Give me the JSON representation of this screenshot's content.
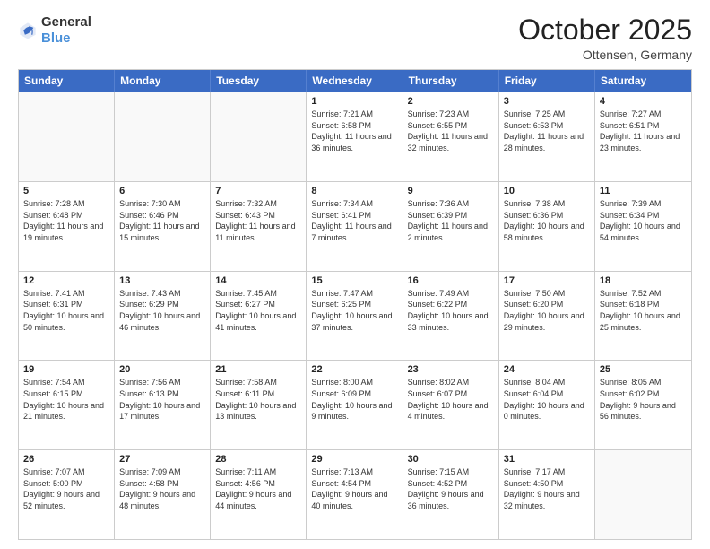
{
  "logo": {
    "general": "General",
    "blue": "Blue"
  },
  "title": "October 2025",
  "location": "Ottensen, Germany",
  "header_days": [
    "Sunday",
    "Monday",
    "Tuesday",
    "Wednesday",
    "Thursday",
    "Friday",
    "Saturday"
  ],
  "weeks": [
    [
      {
        "day": "",
        "sunrise": "",
        "sunset": "",
        "daylight": ""
      },
      {
        "day": "",
        "sunrise": "",
        "sunset": "",
        "daylight": ""
      },
      {
        "day": "",
        "sunrise": "",
        "sunset": "",
        "daylight": ""
      },
      {
        "day": "1",
        "sunrise": "Sunrise: 7:21 AM",
        "sunset": "Sunset: 6:58 PM",
        "daylight": "Daylight: 11 hours and 36 minutes."
      },
      {
        "day": "2",
        "sunrise": "Sunrise: 7:23 AM",
        "sunset": "Sunset: 6:55 PM",
        "daylight": "Daylight: 11 hours and 32 minutes."
      },
      {
        "day": "3",
        "sunrise": "Sunrise: 7:25 AM",
        "sunset": "Sunset: 6:53 PM",
        "daylight": "Daylight: 11 hours and 28 minutes."
      },
      {
        "day": "4",
        "sunrise": "Sunrise: 7:27 AM",
        "sunset": "Sunset: 6:51 PM",
        "daylight": "Daylight: 11 hours and 23 minutes."
      }
    ],
    [
      {
        "day": "5",
        "sunrise": "Sunrise: 7:28 AM",
        "sunset": "Sunset: 6:48 PM",
        "daylight": "Daylight: 11 hours and 19 minutes."
      },
      {
        "day": "6",
        "sunrise": "Sunrise: 7:30 AM",
        "sunset": "Sunset: 6:46 PM",
        "daylight": "Daylight: 11 hours and 15 minutes."
      },
      {
        "day": "7",
        "sunrise": "Sunrise: 7:32 AM",
        "sunset": "Sunset: 6:43 PM",
        "daylight": "Daylight: 11 hours and 11 minutes."
      },
      {
        "day": "8",
        "sunrise": "Sunrise: 7:34 AM",
        "sunset": "Sunset: 6:41 PM",
        "daylight": "Daylight: 11 hours and 7 minutes."
      },
      {
        "day": "9",
        "sunrise": "Sunrise: 7:36 AM",
        "sunset": "Sunset: 6:39 PM",
        "daylight": "Daylight: 11 hours and 2 minutes."
      },
      {
        "day": "10",
        "sunrise": "Sunrise: 7:38 AM",
        "sunset": "Sunset: 6:36 PM",
        "daylight": "Daylight: 10 hours and 58 minutes."
      },
      {
        "day": "11",
        "sunrise": "Sunrise: 7:39 AM",
        "sunset": "Sunset: 6:34 PM",
        "daylight": "Daylight: 10 hours and 54 minutes."
      }
    ],
    [
      {
        "day": "12",
        "sunrise": "Sunrise: 7:41 AM",
        "sunset": "Sunset: 6:31 PM",
        "daylight": "Daylight: 10 hours and 50 minutes."
      },
      {
        "day": "13",
        "sunrise": "Sunrise: 7:43 AM",
        "sunset": "Sunset: 6:29 PM",
        "daylight": "Daylight: 10 hours and 46 minutes."
      },
      {
        "day": "14",
        "sunrise": "Sunrise: 7:45 AM",
        "sunset": "Sunset: 6:27 PM",
        "daylight": "Daylight: 10 hours and 41 minutes."
      },
      {
        "day": "15",
        "sunrise": "Sunrise: 7:47 AM",
        "sunset": "Sunset: 6:25 PM",
        "daylight": "Daylight: 10 hours and 37 minutes."
      },
      {
        "day": "16",
        "sunrise": "Sunrise: 7:49 AM",
        "sunset": "Sunset: 6:22 PM",
        "daylight": "Daylight: 10 hours and 33 minutes."
      },
      {
        "day": "17",
        "sunrise": "Sunrise: 7:50 AM",
        "sunset": "Sunset: 6:20 PM",
        "daylight": "Daylight: 10 hours and 29 minutes."
      },
      {
        "day": "18",
        "sunrise": "Sunrise: 7:52 AM",
        "sunset": "Sunset: 6:18 PM",
        "daylight": "Daylight: 10 hours and 25 minutes."
      }
    ],
    [
      {
        "day": "19",
        "sunrise": "Sunrise: 7:54 AM",
        "sunset": "Sunset: 6:15 PM",
        "daylight": "Daylight: 10 hours and 21 minutes."
      },
      {
        "day": "20",
        "sunrise": "Sunrise: 7:56 AM",
        "sunset": "Sunset: 6:13 PM",
        "daylight": "Daylight: 10 hours and 17 minutes."
      },
      {
        "day": "21",
        "sunrise": "Sunrise: 7:58 AM",
        "sunset": "Sunset: 6:11 PM",
        "daylight": "Daylight: 10 hours and 13 minutes."
      },
      {
        "day": "22",
        "sunrise": "Sunrise: 8:00 AM",
        "sunset": "Sunset: 6:09 PM",
        "daylight": "Daylight: 10 hours and 9 minutes."
      },
      {
        "day": "23",
        "sunrise": "Sunrise: 8:02 AM",
        "sunset": "Sunset: 6:07 PM",
        "daylight": "Daylight: 10 hours and 4 minutes."
      },
      {
        "day": "24",
        "sunrise": "Sunrise: 8:04 AM",
        "sunset": "Sunset: 6:04 PM",
        "daylight": "Daylight: 10 hours and 0 minutes."
      },
      {
        "day": "25",
        "sunrise": "Sunrise: 8:05 AM",
        "sunset": "Sunset: 6:02 PM",
        "daylight": "Daylight: 9 hours and 56 minutes."
      }
    ],
    [
      {
        "day": "26",
        "sunrise": "Sunrise: 7:07 AM",
        "sunset": "Sunset: 5:00 PM",
        "daylight": "Daylight: 9 hours and 52 minutes."
      },
      {
        "day": "27",
        "sunrise": "Sunrise: 7:09 AM",
        "sunset": "Sunset: 4:58 PM",
        "daylight": "Daylight: 9 hours and 48 minutes."
      },
      {
        "day": "28",
        "sunrise": "Sunrise: 7:11 AM",
        "sunset": "Sunset: 4:56 PM",
        "daylight": "Daylight: 9 hours and 44 minutes."
      },
      {
        "day": "29",
        "sunrise": "Sunrise: 7:13 AM",
        "sunset": "Sunset: 4:54 PM",
        "daylight": "Daylight: 9 hours and 40 minutes."
      },
      {
        "day": "30",
        "sunrise": "Sunrise: 7:15 AM",
        "sunset": "Sunset: 4:52 PM",
        "daylight": "Daylight: 9 hours and 36 minutes."
      },
      {
        "day": "31",
        "sunrise": "Sunrise: 7:17 AM",
        "sunset": "Sunset: 4:50 PM",
        "daylight": "Daylight: 9 hours and 32 minutes."
      },
      {
        "day": "",
        "sunrise": "",
        "sunset": "",
        "daylight": ""
      }
    ]
  ]
}
